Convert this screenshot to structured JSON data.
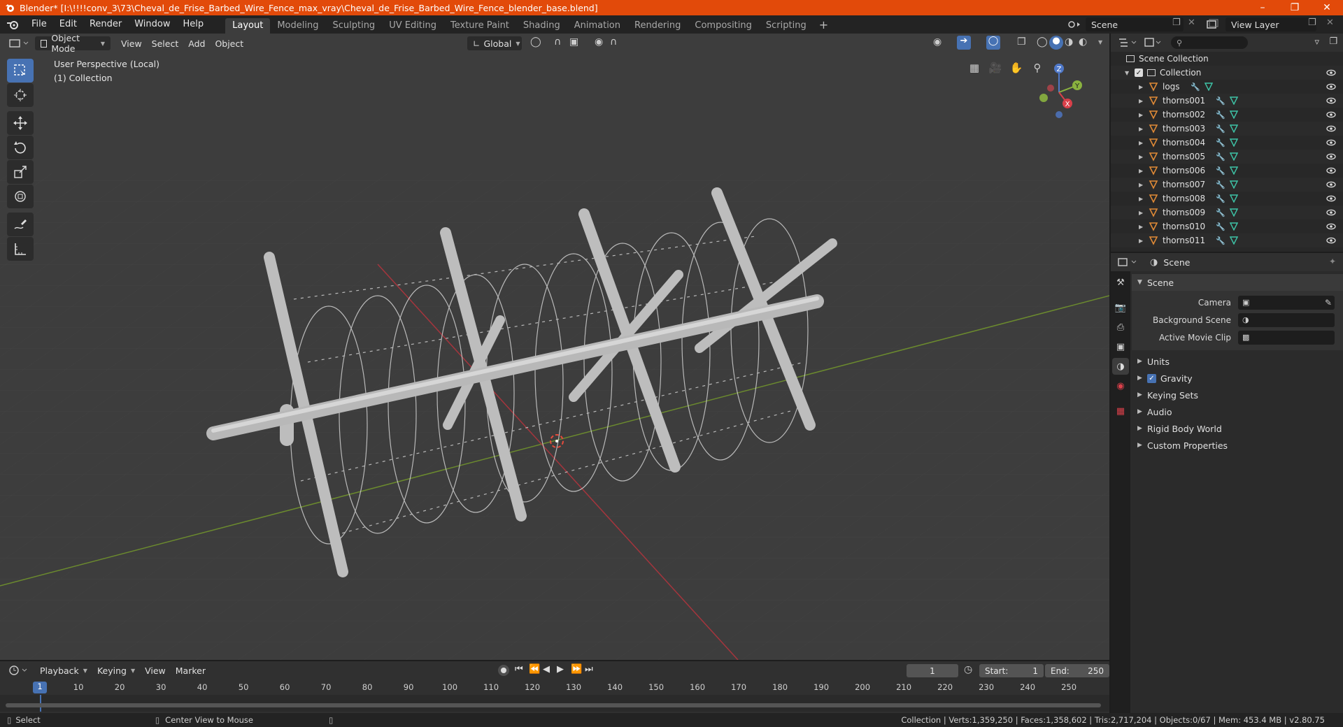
{
  "window": {
    "title": "Blender* [I:\\!!!!conv_3\\73\\Cheval_de_Frise_Barbed_Wire_Fence_max_vray\\Cheval_de_Frise_Barbed_Wire_Fence_blender_base.blend]",
    "accent": "#e24a0a"
  },
  "menu": {
    "items": [
      "File",
      "Edit",
      "Render",
      "Window",
      "Help"
    ],
    "workspaces": [
      "Layout",
      "Modeling",
      "Sculpting",
      "UV Editing",
      "Texture Paint",
      "Shading",
      "Animation",
      "Rendering",
      "Compositing",
      "Scripting"
    ],
    "active_workspace": "Layout",
    "scene": "Scene",
    "view_layer": "View Layer"
  },
  "viewport": {
    "mode": "Object Mode",
    "menus": [
      "View",
      "Select",
      "Add",
      "Object"
    ],
    "transform_orientation": "Global",
    "info_line1": "User Perspective (Local)",
    "info_line2": "(1) Collection",
    "axis_x": "X",
    "axis_y": "Y",
    "axis_z": "Z"
  },
  "timeline": {
    "menus": [
      "Playback",
      "Keying",
      "View",
      "Marker"
    ],
    "current_frame": "1",
    "start_label": "Start:",
    "start": "1",
    "end_label": "End:",
    "end": "250",
    "ruler": [
      "1",
      "10",
      "20",
      "30",
      "40",
      "50",
      "60",
      "70",
      "80",
      "90",
      "100",
      "110",
      "120",
      "130",
      "140",
      "150",
      "160",
      "170",
      "180",
      "190",
      "200",
      "210",
      "220",
      "230",
      "240",
      "250"
    ]
  },
  "statusbar": {
    "left": "Select",
    "middle": "Center View to Mouse",
    "stats": "Collection | Verts:1,359,250 | Faces:1,358,602 | Tris:2,717,204 | Objects:0/67 | Mem: 453.4 MB | v2.80.75"
  },
  "outliner": {
    "root": "Scene Collection",
    "collection": "Collection",
    "objects": [
      "logs",
      "thorns001",
      "thorns002",
      "thorns003",
      "thorns004",
      "thorns005",
      "thorns006",
      "thorns007",
      "thorns008",
      "thorns009",
      "thorns010",
      "thorns011"
    ]
  },
  "properties": {
    "header": "Scene",
    "panel": "Scene",
    "camera_label": "Camera",
    "bg_scene_label": "Background Scene",
    "movie_clip_label": "Active Movie Clip",
    "subpanels": [
      "Units",
      "Gravity",
      "Keying Sets",
      "Audio",
      "Rigid Body World",
      "Custom Properties"
    ],
    "gravity_checked": true
  }
}
